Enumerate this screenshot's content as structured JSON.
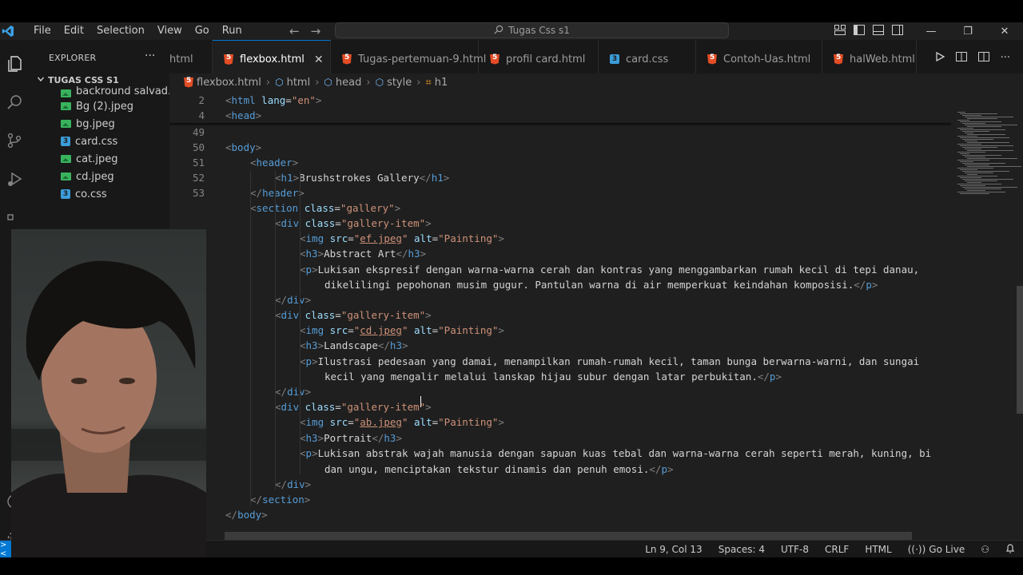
{
  "window": {
    "menu": [
      "File",
      "Edit",
      "Selection",
      "View",
      "Go",
      "Run"
    ],
    "search_placeholder": "Tugas Css s1"
  },
  "sidebar": {
    "title": "EXPLORER",
    "more": "···",
    "folder": "TUGAS CSS S1",
    "files": [
      {
        "name": "backround salvad...",
        "type": "image"
      },
      {
        "name": "Bg (2).jpeg",
        "type": "image"
      },
      {
        "name": "bg.jpeg",
        "type": "image"
      },
      {
        "name": "card.css",
        "type": "css"
      },
      {
        "name": "cat.jpeg",
        "type": "image"
      },
      {
        "name": "cd.jpeg",
        "type": "image"
      },
      {
        "name": "co.css",
        "type": "css"
      }
    ]
  },
  "tabs": [
    {
      "label": "html",
      "active": false,
      "icon": "html-icon"
    },
    {
      "label": "flexbox.html",
      "active": true,
      "icon": "html-icon"
    },
    {
      "label": "Tugas-pertemuan-9.html",
      "active": false,
      "icon": "html-icon"
    },
    {
      "label": "profil card.html",
      "active": false,
      "icon": "html-icon"
    },
    {
      "label": "card.css",
      "active": false,
      "icon": "css-icon"
    },
    {
      "label": "Contoh-Uas.html",
      "active": false,
      "icon": "html-icon"
    },
    {
      "label": "halWeb.html",
      "active": false,
      "icon": "html-icon"
    }
  ],
  "breadcrumb": [
    "flexbox.html",
    "html",
    "head",
    "style",
    "h1"
  ],
  "editor": {
    "lines": [
      {
        "n": "2",
        "indent": 0,
        "parts": [
          [
            "br",
            "<"
          ],
          [
            "tag",
            "html"
          ],
          [
            "t",
            " "
          ],
          [
            "attr",
            "lang"
          ],
          [
            "t",
            "="
          ],
          [
            "str",
            "\"en\""
          ],
          [
            "br",
            ">"
          ]
        ]
      },
      {
        "n": "4",
        "indent": 0,
        "parts": [
          [
            "br",
            "<"
          ],
          [
            "tag",
            "head"
          ],
          [
            "br",
            ">"
          ]
        ]
      },
      {
        "n": "49",
        "indent": 0,
        "parts": []
      },
      {
        "n": "50",
        "indent": 0,
        "parts": [
          [
            "br",
            "<"
          ],
          [
            "tag",
            "body"
          ],
          [
            "br",
            ">"
          ]
        ]
      },
      {
        "n": "51",
        "indent": 1,
        "parts": [
          [
            "br",
            "<"
          ],
          [
            "tag",
            "header"
          ],
          [
            "br",
            ">"
          ]
        ]
      },
      {
        "n": "52",
        "indent": 2,
        "parts": [
          [
            "br",
            "<"
          ],
          [
            "tag",
            "h1"
          ],
          [
            "br",
            ">"
          ],
          [
            "t",
            "Brushstrokes Gallery"
          ],
          [
            "br",
            "</"
          ],
          [
            "tag",
            "h1"
          ],
          [
            "br",
            ">"
          ]
        ]
      },
      {
        "n": "53",
        "indent": 1,
        "parts": [
          [
            "br",
            "</"
          ],
          [
            "tag",
            "header"
          ],
          [
            "br",
            ">"
          ]
        ]
      },
      {
        "n": "",
        "indent": 1,
        "parts": [
          [
            "br",
            "<"
          ],
          [
            "tag",
            "section"
          ],
          [
            "t",
            " "
          ],
          [
            "attr",
            "class"
          ],
          [
            "t",
            "="
          ],
          [
            "str",
            "\"gallery\""
          ],
          [
            "br",
            ">"
          ]
        ]
      },
      {
        "n": "",
        "indent": 2,
        "parts": [
          [
            "br",
            "<"
          ],
          [
            "tag",
            "div"
          ],
          [
            "t",
            " "
          ],
          [
            "attr",
            "class"
          ],
          [
            "t",
            "="
          ],
          [
            "str",
            "\"gallery-item\""
          ],
          [
            "br",
            ">"
          ]
        ]
      },
      {
        "n": "",
        "indent": 3,
        "parts": [
          [
            "br",
            "<"
          ],
          [
            "tag",
            "img"
          ],
          [
            "t",
            " "
          ],
          [
            "attr",
            "src"
          ],
          [
            "t",
            "="
          ],
          [
            "str",
            "\""
          ],
          [
            "ul",
            "ef.jpeg"
          ],
          [
            "str",
            "\""
          ],
          [
            "t",
            " "
          ],
          [
            "attr",
            "alt"
          ],
          [
            "t",
            "="
          ],
          [
            "str",
            "\"Painting\""
          ],
          [
            "br",
            ">"
          ]
        ]
      },
      {
        "n": "",
        "indent": 3,
        "parts": [
          [
            "br",
            "<"
          ],
          [
            "tag",
            "h3"
          ],
          [
            "br",
            ">"
          ],
          [
            "t",
            "Abstract Art"
          ],
          [
            "br",
            "</"
          ],
          [
            "tag",
            "h3"
          ],
          [
            "br",
            ">"
          ]
        ]
      },
      {
        "n": "",
        "indent": 3,
        "parts": [
          [
            "br",
            "<"
          ],
          [
            "tag",
            "p"
          ],
          [
            "br",
            ">"
          ],
          [
            "t",
            "Lukisan ekspresif dengan warna-warna cerah dan kontras yang menggambarkan rumah kecil di tepi danau,"
          ]
        ]
      },
      {
        "n": "",
        "indent": 4,
        "parts": [
          [
            "t",
            "dikelilingi pepohonan musim gugur. Pantulan warna di air memperkuat keindahan komposisi."
          ],
          [
            "br",
            "</"
          ],
          [
            "tag",
            "p"
          ],
          [
            "br",
            ">"
          ]
        ]
      },
      {
        "n": "",
        "indent": 2,
        "parts": [
          [
            "br",
            "</"
          ],
          [
            "tag",
            "div"
          ],
          [
            "br",
            ">"
          ]
        ]
      },
      {
        "n": "",
        "indent": 2,
        "parts": [
          [
            "br",
            "<"
          ],
          [
            "tag",
            "div"
          ],
          [
            "t",
            " "
          ],
          [
            "attr",
            "class"
          ],
          [
            "t",
            "="
          ],
          [
            "str",
            "\"gallery-item\""
          ],
          [
            "br",
            ">"
          ]
        ]
      },
      {
        "n": "",
        "indent": 3,
        "parts": [
          [
            "br",
            "<"
          ],
          [
            "tag",
            "img"
          ],
          [
            "t",
            " "
          ],
          [
            "attr",
            "src"
          ],
          [
            "t",
            "="
          ],
          [
            "str",
            "\""
          ],
          [
            "ul",
            "cd.jpeg"
          ],
          [
            "str",
            "\""
          ],
          [
            "t",
            " "
          ],
          [
            "attr",
            "alt"
          ],
          [
            "t",
            "="
          ],
          [
            "str",
            "\"Painting\""
          ],
          [
            "br",
            ">"
          ]
        ]
      },
      {
        "n": "",
        "indent": 3,
        "parts": [
          [
            "br",
            "<"
          ],
          [
            "tag",
            "h3"
          ],
          [
            "br",
            ">"
          ],
          [
            "t",
            "Landscape"
          ],
          [
            "br",
            "</"
          ],
          [
            "tag",
            "h3"
          ],
          [
            "br",
            ">"
          ]
        ]
      },
      {
        "n": "",
        "indent": 3,
        "parts": [
          [
            "br",
            "<"
          ],
          [
            "tag",
            "p"
          ],
          [
            "br",
            ">"
          ],
          [
            "t",
            "Ilustrasi pedesaan yang damai, menampilkan rumah-rumah kecil, taman bunga berwarna-warni, dan sungai"
          ]
        ]
      },
      {
        "n": "",
        "indent": 4,
        "parts": [
          [
            "t",
            "kecil yang mengalir melalui lanskap hijau subur dengan latar perbukitan."
          ],
          [
            "br",
            "</"
          ],
          [
            "tag",
            "p"
          ],
          [
            "br",
            ">"
          ]
        ]
      },
      {
        "n": "",
        "indent": 2,
        "parts": [
          [
            "br",
            "</"
          ],
          [
            "tag",
            "div"
          ],
          [
            "br",
            ">"
          ]
        ]
      },
      {
        "n": "",
        "indent": 2,
        "parts": [
          [
            "br",
            "<"
          ],
          [
            "tag",
            "div"
          ],
          [
            "t",
            " "
          ],
          [
            "attr",
            "class"
          ],
          [
            "t",
            "="
          ],
          [
            "str",
            "\"gallery-item\""
          ],
          [
            "br",
            ">"
          ]
        ]
      },
      {
        "n": "",
        "indent": 3,
        "parts": [
          [
            "br",
            "<"
          ],
          [
            "tag",
            "img"
          ],
          [
            "t",
            " "
          ],
          [
            "attr",
            "src"
          ],
          [
            "t",
            "="
          ],
          [
            "str",
            "\""
          ],
          [
            "ul",
            "ab.jpeg"
          ],
          [
            "str",
            "\""
          ],
          [
            "t",
            " "
          ],
          [
            "attr",
            "alt"
          ],
          [
            "t",
            "="
          ],
          [
            "str",
            "\"Painting\""
          ],
          [
            "br",
            ">"
          ]
        ]
      },
      {
        "n": "",
        "indent": 3,
        "parts": [
          [
            "br",
            "<"
          ],
          [
            "tag",
            "h3"
          ],
          [
            "br",
            ">"
          ],
          [
            "t",
            "Portrait"
          ],
          [
            "br",
            "</"
          ],
          [
            "tag",
            "h3"
          ],
          [
            "br",
            ">"
          ]
        ]
      },
      {
        "n": "",
        "indent": 3,
        "parts": [
          [
            "br",
            "<"
          ],
          [
            "tag",
            "p"
          ],
          [
            "br",
            ">"
          ],
          [
            "t",
            "Lukisan abstrak wajah manusia dengan sapuan kuas tebal dan warna-warna cerah seperti merah, kuning, bi"
          ]
        ]
      },
      {
        "n": "",
        "indent": 4,
        "parts": [
          [
            "t",
            "dan ungu, menciptakan tekstur dinamis dan penuh emosi."
          ],
          [
            "br",
            "</"
          ],
          [
            "tag",
            "p"
          ],
          [
            "br",
            ">"
          ]
        ]
      },
      {
        "n": "",
        "indent": 2,
        "parts": [
          [
            "br",
            "</"
          ],
          [
            "tag",
            "div"
          ],
          [
            "br",
            ">"
          ]
        ]
      },
      {
        "n": "",
        "indent": 1,
        "parts": [
          [
            "br",
            "</"
          ],
          [
            "tag",
            "section"
          ],
          [
            "br",
            ">"
          ]
        ]
      },
      {
        "n": "",
        "indent": 0,
        "parts": [
          [
            "br",
            "</"
          ],
          [
            "tag",
            "body"
          ],
          [
            "br",
            ">"
          ]
        ]
      }
    ]
  },
  "statusbar": {
    "position": "Ln 9, Col 13",
    "spaces": "Spaces: 4",
    "encoding": "UTF-8",
    "eol": "CRLF",
    "language": "HTML",
    "live": "Go Live"
  },
  "colors": {
    "accent": "#0078d4",
    "tag": "#569cd6",
    "attr": "#9cdcfe",
    "string": "#ce9178"
  }
}
